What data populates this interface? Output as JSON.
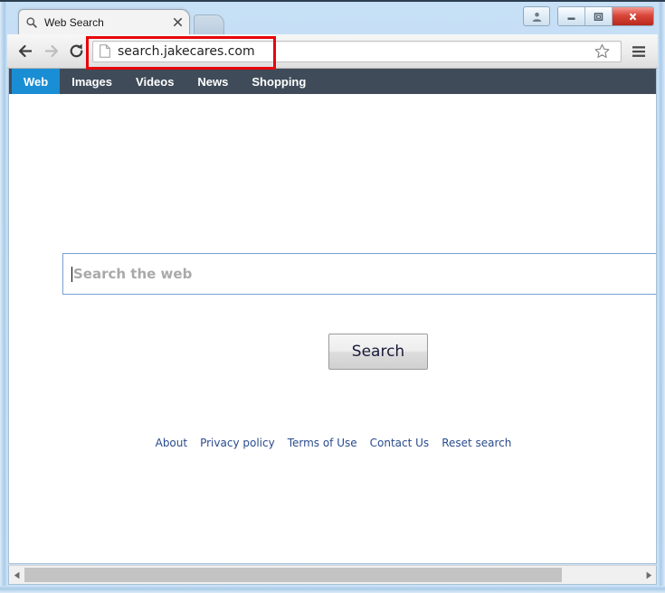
{
  "window": {
    "title": "Web Search",
    "controls": {
      "user_icon": "user-account-icon",
      "minimize_label": "Minimize",
      "maximize_label": "Maximize",
      "close_label": "Close"
    }
  },
  "tab": {
    "favicon": "search-magnifier-icon",
    "title": "Web Search",
    "close_label": "×",
    "new_tab_label": "New tab"
  },
  "toolbar": {
    "back_label": "Back",
    "forward_label": "Forward",
    "reload_label": "Reload",
    "page_icon": "document-page-icon",
    "url": "search.jakecares.com",
    "bookmark_label": "Bookmark this page",
    "menu_label": "Customize and control"
  },
  "annotation": {
    "highlight_color": "#e8060a",
    "target": "address-bar"
  },
  "site": {
    "nav": [
      {
        "label": "Web",
        "active": true
      },
      {
        "label": "Images",
        "active": false
      },
      {
        "label": "Videos",
        "active": false
      },
      {
        "label": "News",
        "active": false
      },
      {
        "label": "Shopping",
        "active": false
      }
    ],
    "search": {
      "value": "",
      "placeholder": "Search the web",
      "button_label": "Search"
    },
    "footer_links": [
      "About",
      "Privacy policy",
      "Terms of Use",
      "Contact Us",
      "Reset search"
    ],
    "colors": {
      "nav_background": "#3f4b59",
      "nav_active": "#1a8ed4",
      "link": "#2a4b8d",
      "input_border": "#7a9fd4"
    }
  },
  "scrollbar": {
    "left_arrow": "◀",
    "right_arrow": "▶"
  }
}
